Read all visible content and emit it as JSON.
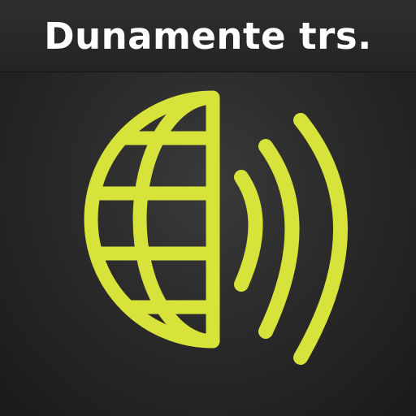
{
  "app": {
    "title": "Dunamente trs."
  },
  "icon": {
    "name": "globe-broadcast-icon",
    "accent_color": "#d7e23a",
    "background_color": "#2a2a2a",
    "banner_color": "#262626"
  }
}
